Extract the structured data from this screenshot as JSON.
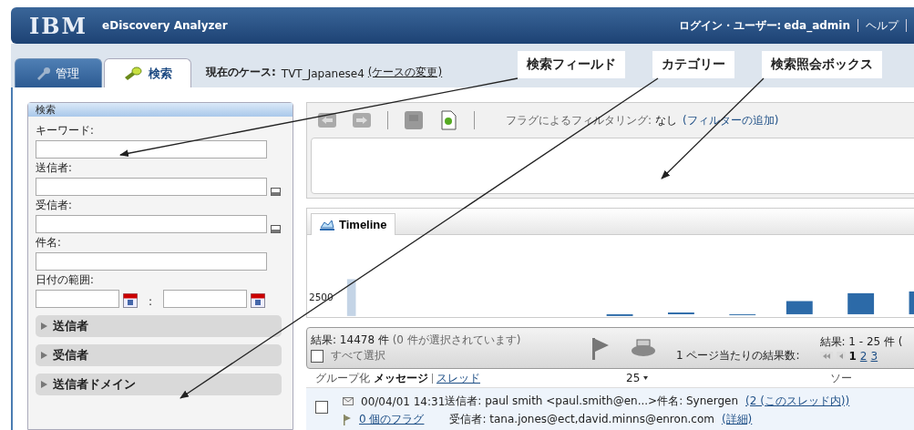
{
  "header": {
    "logo": "IBM",
    "app_title": "eDiscovery Analyzer",
    "user_label": "ログイン・ユーザー:",
    "user": "eda_admin",
    "help": "ヘルプ"
  },
  "tabs": [
    {
      "label": "管理",
      "selected": false
    },
    {
      "label": "検索",
      "selected": true
    }
  ],
  "case": {
    "label": "現在のケース:",
    "name": "TVT_Japanese4",
    "change_link": "(ケースの変更)"
  },
  "callouts": [
    {
      "label": "検索フィールド"
    },
    {
      "label": "カテゴリー"
    },
    {
      "label": "検索照会ボックス"
    }
  ],
  "search_panel": {
    "title": "検索",
    "fields": [
      {
        "label": "キーワード:",
        "kind": "text"
      },
      {
        "label": "送信者:",
        "kind": "picker"
      },
      {
        "label": "受信者:",
        "kind": "picker"
      },
      {
        "label": "件名:",
        "kind": "text"
      }
    ],
    "date_range": {
      "label": "日付の範囲:",
      "separator": ":"
    },
    "sections": [
      {
        "label": "送信者",
        "expanded": false
      },
      {
        "label": "受信者",
        "expanded": false
      },
      {
        "label": "送信者ドメイン",
        "expanded": false
      }
    ]
  },
  "toolbar": {
    "filter_label": "フラグによるフィルタリング:",
    "filter_value": "なし",
    "add_filter": "(フィルターの追加)"
  },
  "timeline": {
    "tab": "Timeline",
    "tick": "2500"
  },
  "results": {
    "count": "結果: 14478 件",
    "selection": "(0 件が選択されています)",
    "select_all": {
      "label": "すべて選択",
      "checked": false
    },
    "per_page_label": "1 ページ当たりの結果数:",
    "per_page": "25",
    "range": "結果: 1 - 25 件 (",
    "pages": [
      {
        "label": "1",
        "selected": true
      },
      {
        "label": "2",
        "selected": false
      },
      {
        "label": "3",
        "selected": false
      }
    ],
    "group_label": "グループ化",
    "group_options": [
      {
        "label": "メッセージ",
        "selected": true
      },
      {
        "label": "スレッド",
        "selected": false
      }
    ],
    "sort": "ソー"
  },
  "messages": [
    {
      "checked": false,
      "date": "00/04/01 14:31",
      "from": "送信者: paul smith <paul.smith@en...>",
      "subject": "件名: Synergen",
      "thread": "(2 (このスレッド内))",
      "flags": "0 個のフラグ",
      "to": "受信者: tana.jones@ect,david.minns@enron.com",
      "details": "(詳細)"
    }
  ]
}
